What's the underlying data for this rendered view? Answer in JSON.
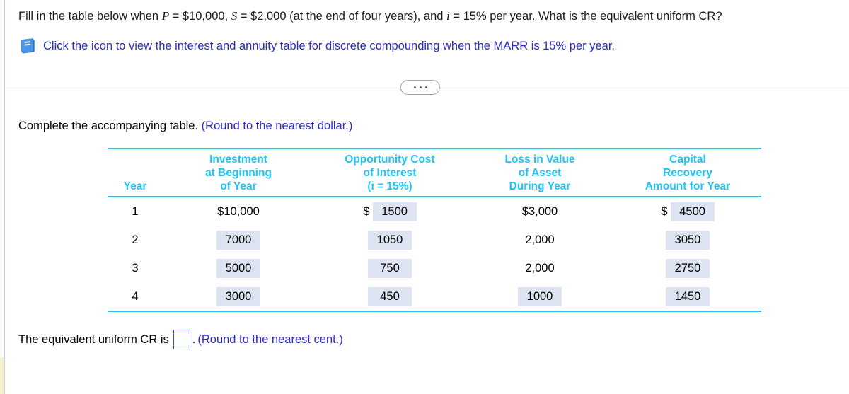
{
  "question": {
    "line1_pre": "Fill in the table below when ",
    "var_p": "P",
    "line1_mid1": " = $10,000,  ",
    "var_s": "S",
    "line1_mid2": " = $2,000 (at the end of four years), and ",
    "var_i": "i",
    "line1_end": " = 15% per year. What is the equivalent uniform CR?",
    "icon_name": "book-icon",
    "icon_link_text": "Click the icon to view the interest and annuity table for discrete compounding when the MARR is 15% per year."
  },
  "divider": {
    "expand_label": "..."
  },
  "instruction": {
    "text": "Complete the accompanying table. ",
    "hint": "(Round to the nearest dollar.)"
  },
  "table": {
    "headers": [
      {
        "lines": [
          "",
          "",
          "Year"
        ]
      },
      {
        "lines": [
          "Investment",
          "at Beginning",
          "of Year"
        ]
      },
      {
        "lines": [
          "Opportunity Cost",
          "of Interest",
          "(i = 15%)"
        ]
      },
      {
        "lines": [
          "Loss in Value",
          "of Asset",
          "During Year"
        ]
      },
      {
        "lines": [
          "Capital",
          "Recovery",
          "Amount for Year"
        ]
      }
    ],
    "rows": [
      {
        "year": "1",
        "investment": {
          "value": "$10,000",
          "editable": false,
          "prefix": ""
        },
        "opportunity": {
          "value": "1500",
          "editable": true,
          "prefix": "$"
        },
        "loss": {
          "value": "$3,000",
          "editable": false,
          "prefix": ""
        },
        "capital": {
          "value": "4500",
          "editable": true,
          "prefix": "$"
        }
      },
      {
        "year": "2",
        "investment": {
          "value": "7000",
          "editable": true,
          "prefix": ""
        },
        "opportunity": {
          "value": "1050",
          "editable": true,
          "prefix": ""
        },
        "loss": {
          "value": "2,000",
          "editable": false,
          "prefix": ""
        },
        "capital": {
          "value": "3050",
          "editable": true,
          "prefix": ""
        }
      },
      {
        "year": "3",
        "investment": {
          "value": "5000",
          "editable": true,
          "prefix": ""
        },
        "opportunity": {
          "value": "750",
          "editable": true,
          "prefix": ""
        },
        "loss": {
          "value": "2,000",
          "editable": false,
          "prefix": ""
        },
        "capital": {
          "value": "2750",
          "editable": true,
          "prefix": ""
        }
      },
      {
        "year": "4",
        "investment": {
          "value": "3000",
          "editable": true,
          "prefix": ""
        },
        "opportunity": {
          "value": "450",
          "editable": true,
          "prefix": ""
        },
        "loss": {
          "value": "1000",
          "editable": true,
          "prefix": ""
        },
        "capital": {
          "value": "1450",
          "editable": true,
          "prefix": ""
        }
      }
    ]
  },
  "answer": {
    "prompt": "The equivalent uniform CR is",
    "value": "",
    "period": ".",
    "hint": "(Round to the nearest cent.)"
  },
  "colors": {
    "table_accent": "#1fc4f4",
    "link_blue": "#2b2bc6",
    "field_fill": "#dde3f0",
    "answer_border": "#3b4ad0"
  }
}
